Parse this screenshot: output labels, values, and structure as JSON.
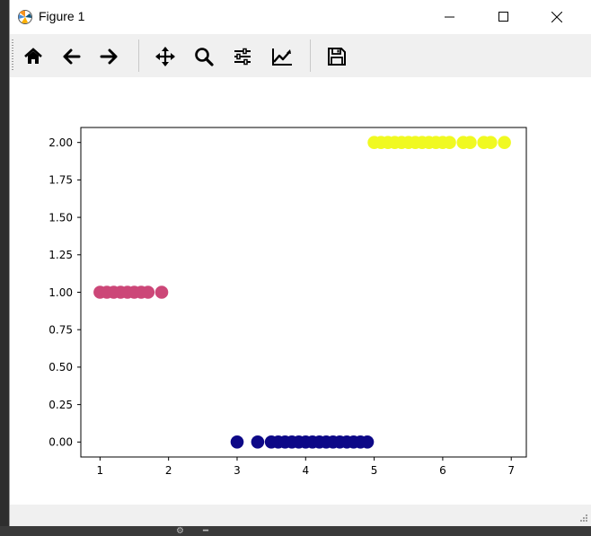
{
  "window": {
    "title": "Figure 1"
  },
  "toolbar": {
    "tools": [
      {
        "id": "home",
        "icon": "home-icon"
      },
      {
        "id": "back",
        "icon": "arrow-left-icon"
      },
      {
        "id": "forward",
        "icon": "arrow-right-icon"
      },
      {
        "id": "pan",
        "icon": "move-icon"
      },
      {
        "id": "zoom",
        "icon": "magnifier-icon"
      },
      {
        "id": "subplots",
        "icon": "sliders-icon"
      },
      {
        "id": "customize",
        "icon": "line-chart-icon"
      },
      {
        "id": "save",
        "icon": "floppy-disk-icon"
      }
    ]
  },
  "chart_data": {
    "type": "scatter",
    "title": "",
    "xlabel": "",
    "ylabel": "",
    "xlim": [
      0.72,
      7.22
    ],
    "ylim": [
      -0.1,
      2.1
    ],
    "xticks": [
      1,
      2,
      3,
      4,
      5,
      6,
      7
    ],
    "yticks": [
      0.0,
      0.25,
      0.5,
      0.75,
      1.0,
      1.25,
      1.5,
      1.75,
      2.0
    ],
    "ytick_labels": [
      "0.00",
      "0.25",
      "0.50",
      "0.75",
      "1.00",
      "1.25",
      "1.50",
      "1.75",
      "2.00"
    ],
    "grid": false,
    "series": [
      {
        "color": "#0d0887",
        "y": 0,
        "x": [
          3.0,
          3.3,
          3.5,
          3.6,
          3.7,
          3.8,
          3.9,
          4.0,
          4.1,
          4.2,
          4.3,
          4.4,
          4.5,
          4.6,
          4.7,
          4.8,
          4.9
        ]
      },
      {
        "color": "#cc4778",
        "y": 1,
        "x": [
          1.0,
          1.1,
          1.2,
          1.3,
          1.4,
          1.5,
          1.6,
          1.7,
          1.9
        ]
      },
      {
        "color": "#f0f921",
        "y": 2,
        "x": [
          5.0,
          5.1,
          5.2,
          5.3,
          5.4,
          5.5,
          5.6,
          5.7,
          5.8,
          5.9,
          6.0,
          6.1,
          6.3,
          6.4,
          6.6,
          6.7,
          6.9
        ]
      }
    ]
  }
}
